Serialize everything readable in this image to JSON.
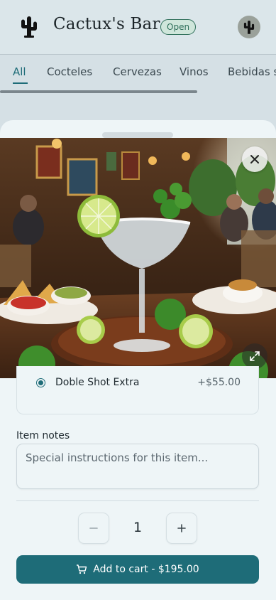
{
  "header": {
    "brand": "Cactux's Bar",
    "status_badge": "Open",
    "logo_icon": "cactus-icon",
    "avatar_icon": "cactus-icon"
  },
  "categories": {
    "tabs": [
      "All",
      "Cocteles",
      "Cervezas",
      "Vinos",
      "Bebidas s"
    ],
    "active": "All"
  },
  "item_sheet": {
    "photo_description_icon": "margarita-photo",
    "option": {
      "label": "Doble Shot Extra",
      "price": "+$55.00",
      "selected": true
    },
    "notes": {
      "label": "Item notes",
      "placeholder": "Special instructions for this item..."
    },
    "quantity": "1",
    "add_to_cart_label": "Add to cart - $195.00"
  },
  "colors": {
    "accent": "#1e6c78",
    "badge": "#2f6f5a",
    "sheet_bg": "#eef5f7"
  }
}
